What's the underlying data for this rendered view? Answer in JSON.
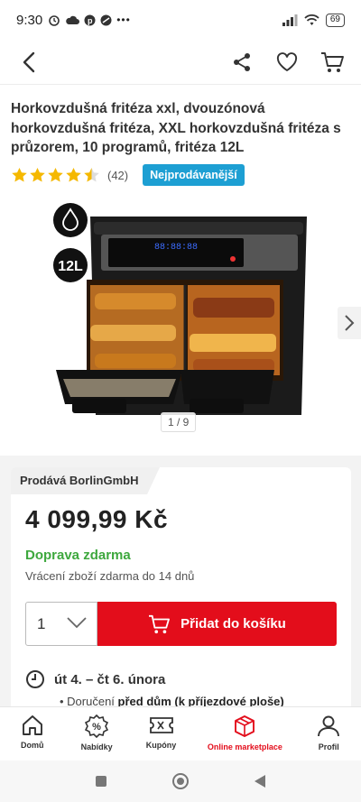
{
  "status_bar": {
    "time": "9:30",
    "battery": "69"
  },
  "product": {
    "title": "Horkovzdušná fritéza xxl, dvouzónová horkovzdušná fritéza, XXL horkovzdušná fritéza s průzorem, 10 programů, fritéza 12L",
    "rating": 4.5,
    "review_count": "(42)",
    "badge": "Nejprodávanější",
    "image_counter": "1 / 9",
    "image_badge_capacity": "12L",
    "device_display": "88:88:88"
  },
  "offer": {
    "seller": "Prodává BorlinGmbH",
    "price": "4 099,99 Kč",
    "shipping": "Doprava zdarma",
    "returns": "Vrácení zboží zdarma do 14 dnů",
    "quantity": "1",
    "add_to_cart": "Přidat do košíku",
    "delivery_date": "út 4. – čt 6. února",
    "delivery_detail_prefix": "Doručení ",
    "delivery_detail_bold": "před dům (k příjezdové ploše)"
  },
  "bottom_nav": [
    {
      "label": "Domů",
      "icon": "home-icon"
    },
    {
      "label": "Nabídky",
      "icon": "percent-badge-icon"
    },
    {
      "label": "Kupóny",
      "icon": "coupon-icon"
    },
    {
      "label": "Online marketplace",
      "icon": "marketplace-box-icon",
      "active": true
    },
    {
      "label": "Profil",
      "icon": "profile-icon"
    }
  ],
  "colors": {
    "accent": "#e30d1b",
    "badge": "#1d9fd3",
    "shipping": "#3ea83e",
    "star": "#f5b800"
  }
}
